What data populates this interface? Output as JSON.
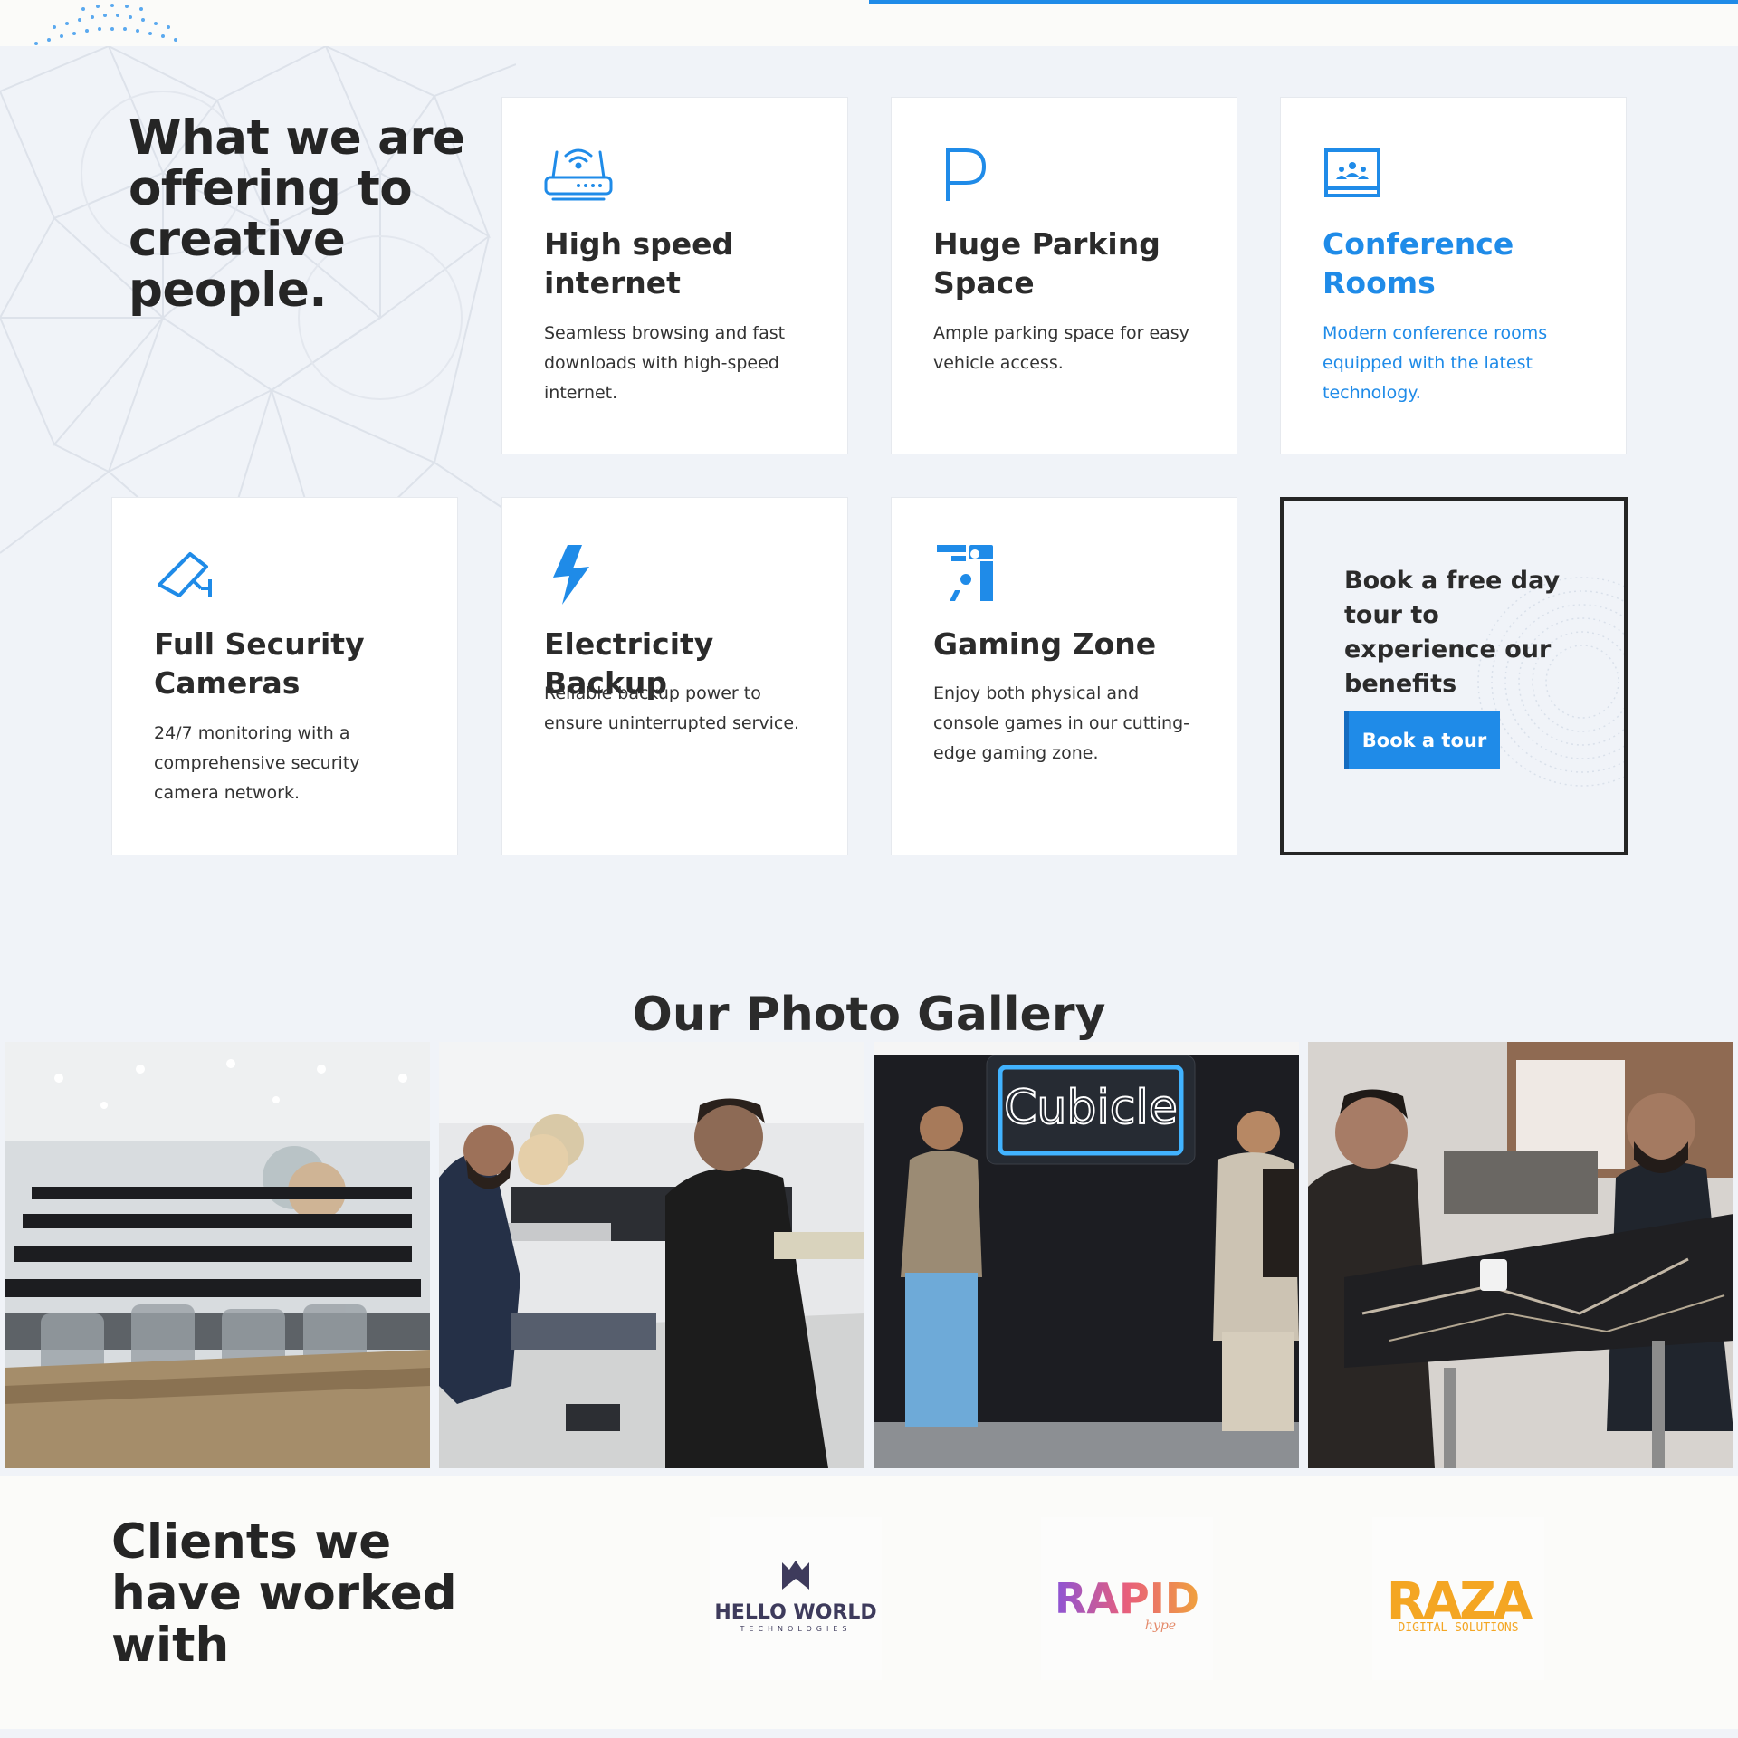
{
  "offerings": {
    "heading": "What we are offering to creative people.",
    "cards": [
      {
        "title": "High speed internet",
        "description": "Seamless browsing and fast downloads with high-speed internet.",
        "icon": "router-wifi-icon"
      },
      {
        "title": "Huge Parking Space",
        "description": "Ample parking space for easy vehicle access.",
        "icon": "parking-icon"
      },
      {
        "title": "Conference Rooms",
        "description": "Modern conference rooms equipped with the latest technology.",
        "icon": "conference-screen-icon"
      },
      {
        "title": "Full Security Cameras",
        "description": "24/7 monitoring with a comprehensive security camera network.",
        "icon": "security-camera-icon"
      },
      {
        "title": "Electricity Backup",
        "description": "Reliable backup power to ensure uninterrupted service.",
        "icon": "lightning-icon"
      },
      {
        "title": "Gaming Zone",
        "description": "Enjoy both physical and console games in our cutting-edge gaming zone.",
        "icon": "gaming-zone-icon"
      }
    ],
    "tour": {
      "text": "Book a free day tour to experience our benefits",
      "button_label": "Book a tour"
    }
  },
  "gallery": {
    "heading": "Our Photo Gallery",
    "photos": [
      {
        "caption": "Coworking hall with desks and chairs"
      },
      {
        "caption": "Two men talking in the workspace"
      },
      {
        "caption": "Two men pointing at Cubicle neon sign",
        "sign_text": "Cubicle"
      },
      {
        "caption": "Men chatting at a marble table"
      }
    ]
  },
  "clients": {
    "heading": "Clients we have worked with",
    "logos": [
      {
        "name": "HELLO WORLD",
        "sub": "TECHNOLOGIES"
      },
      {
        "name": "RAPID",
        "sub": "hype"
      },
      {
        "name": "RAZA",
        "sub": "DIGITAL SOLUTIONS"
      }
    ]
  },
  "colors": {
    "accent": "#1f8be8",
    "heading": "#252525",
    "section_bg": "#f0f3f8"
  }
}
